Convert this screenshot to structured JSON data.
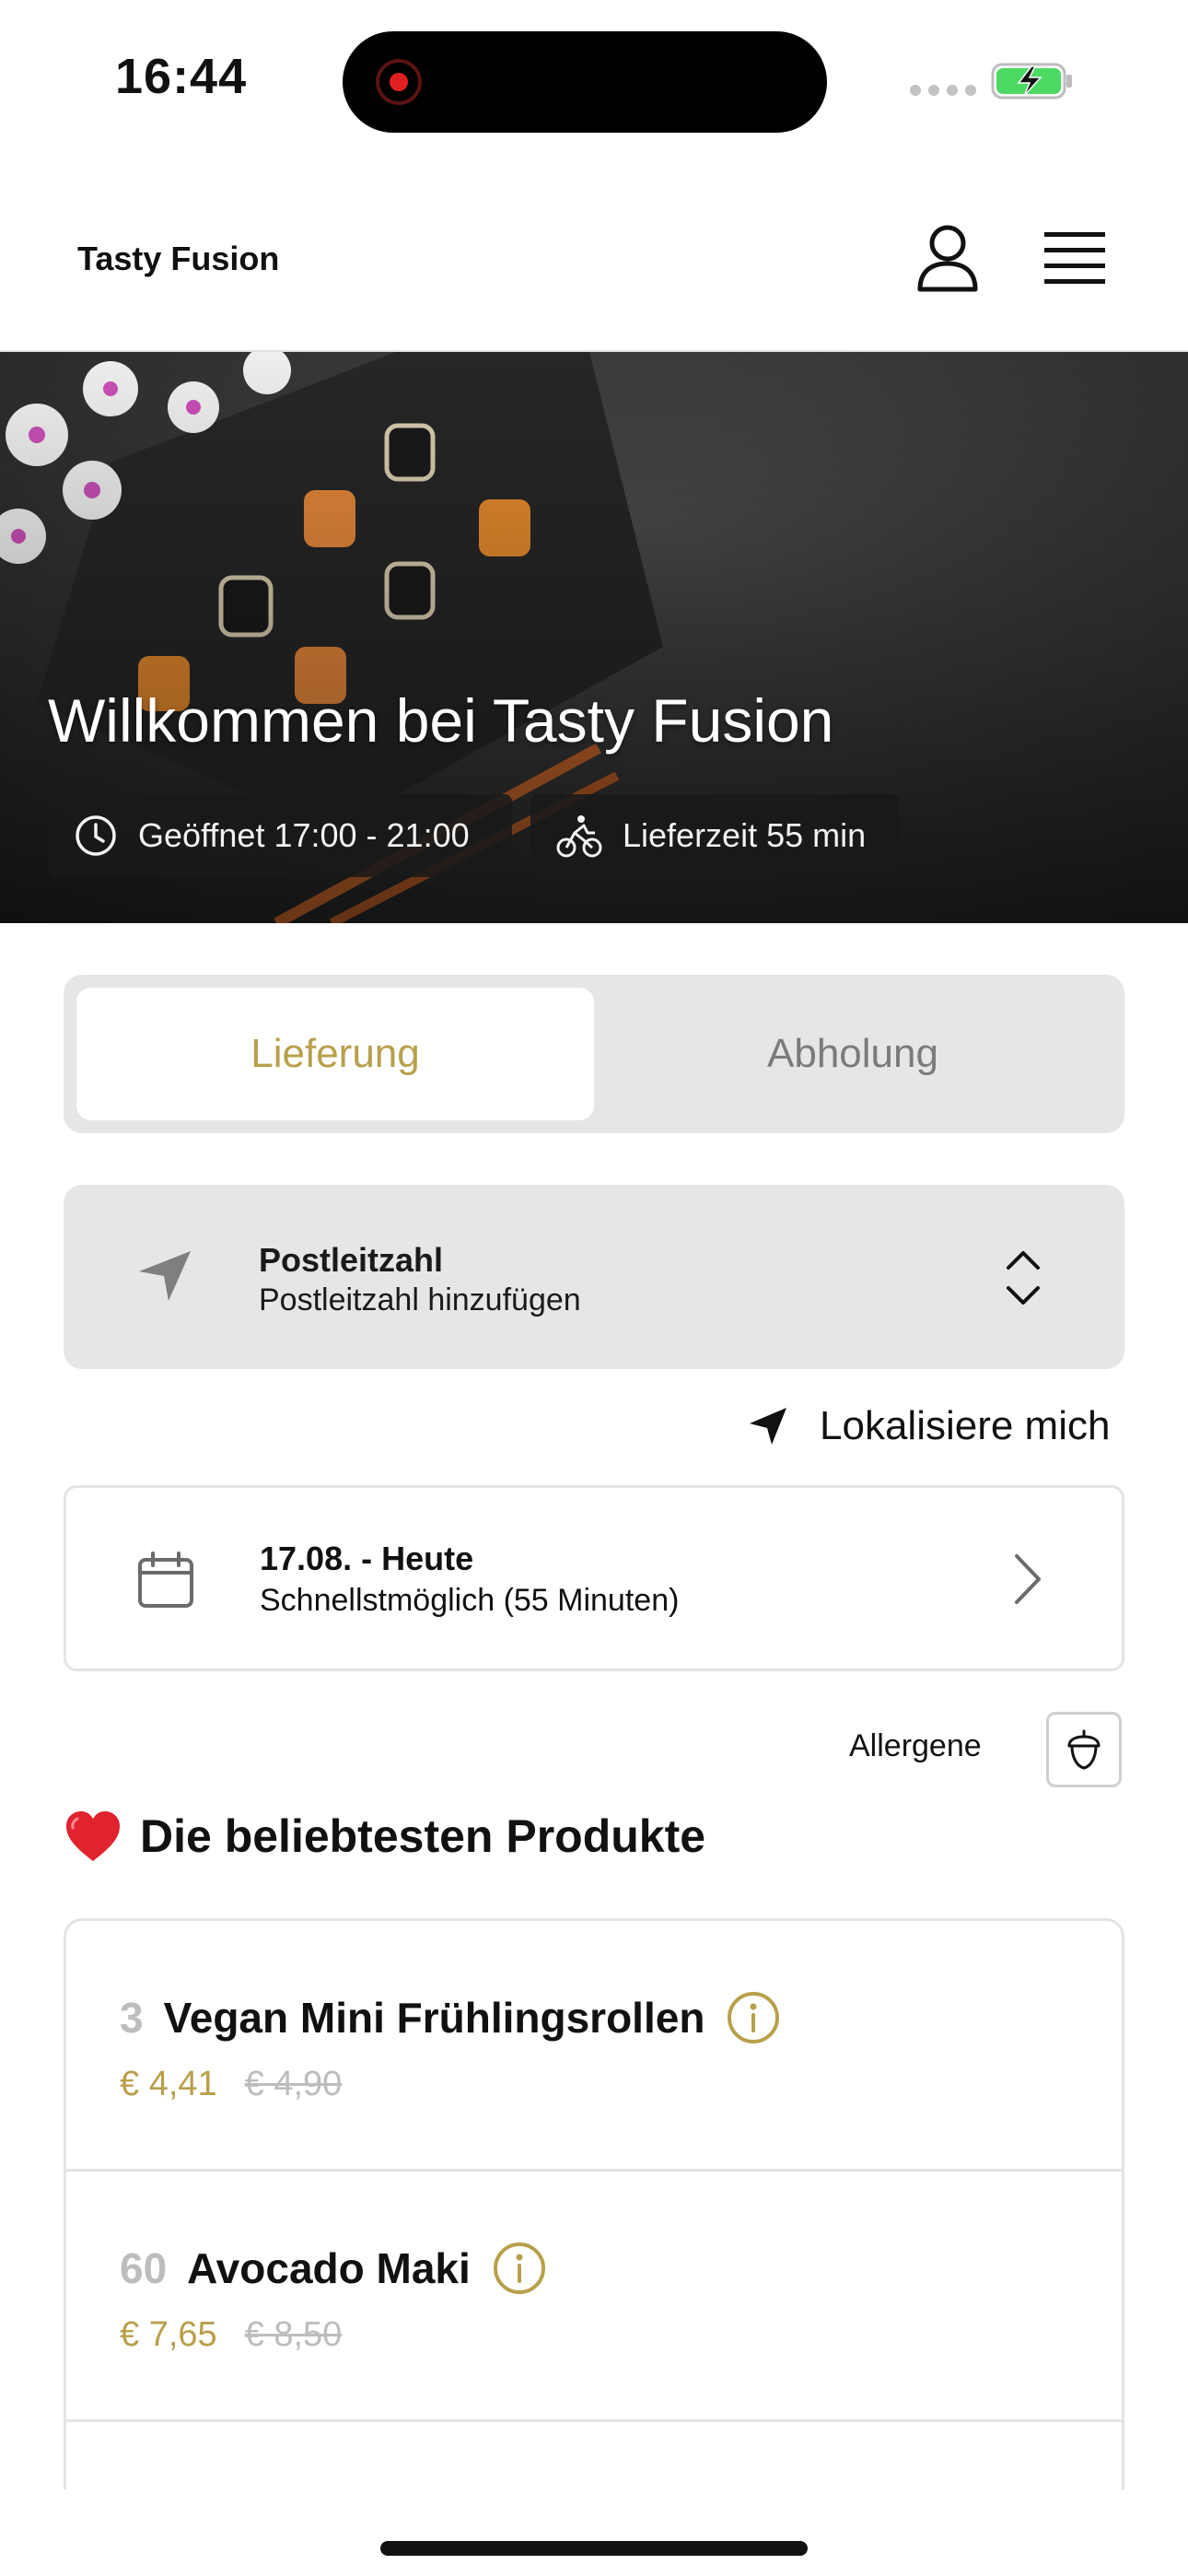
{
  "status_bar": {
    "time": "16:44",
    "battery_level": "charging",
    "icons": [
      "recording-indicator-icon",
      "cellular-signal-icon",
      "battery-charging-icon"
    ]
  },
  "header": {
    "brand": "Tasty Fusion",
    "icons": [
      "user-icon",
      "menu-icon"
    ]
  },
  "hero": {
    "title": "Willkommen bei Tasty Fusion",
    "opening_hours": "Geöffnet 17:00 - 21:00",
    "delivery_time": "Lieferzeit 55 min",
    "icons": [
      "clock-icon",
      "bicycle-icon"
    ]
  },
  "order_mode": {
    "tabs": [
      {
        "label": "Lieferung",
        "selected": true
      },
      {
        "label": "Abholung",
        "selected": false
      }
    ]
  },
  "postal": {
    "title": "Postleitzahl",
    "placeholder": "Postleitzahl hinzufügen",
    "icons": [
      "navigation-arrow-icon",
      "chevron-up-down-icon"
    ]
  },
  "locate": {
    "label": "Lokalisiere mich"
  },
  "schedule": {
    "date": "17.08. - Heute",
    "time": "Schnellstmöglich (55 Minuten)",
    "icons": [
      "calendar-icon",
      "chevron-right-icon"
    ]
  },
  "allergens": {
    "label": "Allergene",
    "icon": "acorn-icon"
  },
  "popular": {
    "title": "Die beliebtesten Produkte",
    "icon": "heart-icon",
    "products": [
      {
        "number": "3",
        "name": "Vegan Mini Frühlingsrollen",
        "price": "€ 4,41",
        "old_price": "€ 4,90"
      },
      {
        "number": "60",
        "name": "Avocado Maki",
        "price": "€ 7,65",
        "old_price": "€ 8,50"
      }
    ]
  },
  "colors": {
    "accent": "#b8a04b",
    "muted": "#bdbdbd",
    "panel": "#e6e6e6",
    "hero_badge": "#191919"
  }
}
